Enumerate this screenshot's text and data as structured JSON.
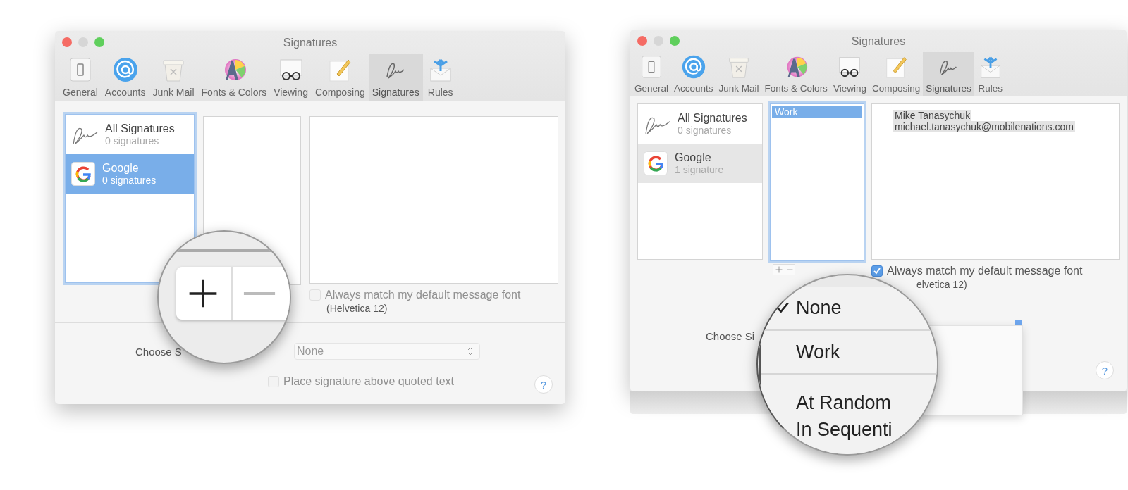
{
  "windows": [
    {
      "title": "Signatures",
      "toolbar": [
        {
          "label": "General",
          "selected": false
        },
        {
          "label": "Accounts",
          "selected": false
        },
        {
          "label": "Junk Mail",
          "selected": false
        },
        {
          "label": "Fonts & Colors",
          "selected": false
        },
        {
          "label": "Viewing",
          "selected": false
        },
        {
          "label": "Composing",
          "selected": false
        },
        {
          "label": "Signatures",
          "selected": true
        },
        {
          "label": "Rules",
          "selected": false
        }
      ],
      "accounts_focused": true,
      "accounts": [
        {
          "kind": "all",
          "name": "All Signatures",
          "count": "0 signatures",
          "selected": false
        },
        {
          "kind": "google",
          "name": "Google",
          "count": "0 signatures",
          "selected": true
        }
      ],
      "signatures_focused": false,
      "font_option": {
        "label": "Always match my default message font",
        "checked": false,
        "disabled": true
      },
      "font_note": "(Helvetica 12)",
      "choose_label": "Choose S",
      "choose_value": "None",
      "place_option": {
        "label": "Place signature above quoted text",
        "checked": false,
        "disabled": true
      },
      "help_label": "?",
      "magnifier": {
        "kind": "buttons"
      }
    },
    {
      "title": "Signatures",
      "toolbar": [
        {
          "label": "General",
          "selected": false
        },
        {
          "label": "Accounts",
          "selected": false
        },
        {
          "label": "Junk Mail",
          "selected": false
        },
        {
          "label": "Fonts & Colors",
          "selected": false
        },
        {
          "label": "Viewing",
          "selected": false
        },
        {
          "label": "Composing",
          "selected": false
        },
        {
          "label": "Signatures",
          "selected": true
        },
        {
          "label": "Rules",
          "selected": false
        }
      ],
      "accounts_focused": false,
      "accounts": [
        {
          "kind": "all",
          "name": "All Signatures",
          "count": "0 signatures",
          "selected": false
        },
        {
          "kind": "google",
          "name": "Google",
          "count": "1 signature",
          "selected": true
        }
      ],
      "signatures_focused": true,
      "signatures": [
        {
          "name": "Work",
          "selected": true
        }
      ],
      "signature_lines": [
        "Mike Tanasychuk",
        "michael.tanasychuk@mobilenations.com"
      ],
      "list_buttons": [
        {
          "kind": "add"
        },
        {
          "kind": "remove"
        }
      ],
      "font_option": {
        "label": "Always match my default message font",
        "checked": true,
        "disabled": false
      },
      "font_note": "elvetica 12)",
      "choose_label": "Choose Si",
      "help_label": "?",
      "magnifier": {
        "kind": "menu",
        "items": [
          {
            "label": "None",
            "checked": true
          },
          {
            "label": "Work",
            "checked": false
          },
          {
            "label": "At Random",
            "checked": false
          },
          {
            "label": "In Sequenti",
            "checked": false
          }
        ]
      }
    }
  ]
}
